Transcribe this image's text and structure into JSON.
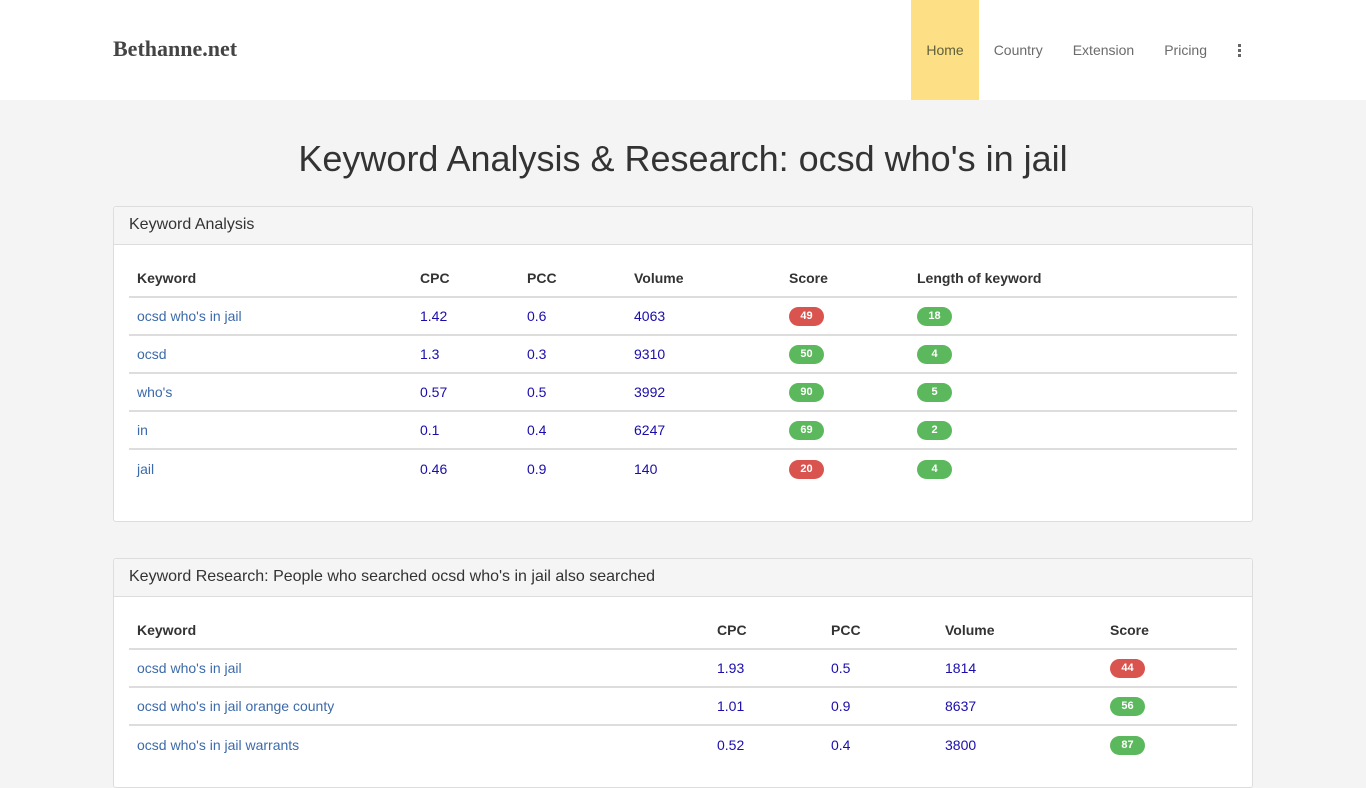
{
  "navbar": {
    "brand": "Bethanne.net",
    "items": [
      {
        "label": "Home",
        "active": true
      },
      {
        "label": "Country",
        "active": false
      },
      {
        "label": "Extension",
        "active": false
      },
      {
        "label": "Pricing",
        "active": false
      }
    ],
    "more_icon": "vertical-ellipsis-icon"
  },
  "page_title": "Keyword Analysis & Research: ocsd who's in jail",
  "analysis": {
    "heading": "Keyword Analysis",
    "columns": [
      "Keyword",
      "CPC",
      "PCC",
      "Volume",
      "Score",
      "Length of keyword"
    ],
    "rows": [
      {
        "keyword": "ocsd who's in jail",
        "cpc": "1.42",
        "pcc": "0.6",
        "volume": "4063",
        "score": "49",
        "score_color": "red",
        "length": "18",
        "length_color": "green"
      },
      {
        "keyword": "ocsd",
        "cpc": "1.3",
        "pcc": "0.3",
        "volume": "9310",
        "score": "50",
        "score_color": "green",
        "length": "4",
        "length_color": "green"
      },
      {
        "keyword": "who's",
        "cpc": "0.57",
        "pcc": "0.5",
        "volume": "3992",
        "score": "90",
        "score_color": "green",
        "length": "5",
        "length_color": "green"
      },
      {
        "keyword": "in",
        "cpc": "0.1",
        "pcc": "0.4",
        "volume": "6247",
        "score": "69",
        "score_color": "green",
        "length": "2",
        "length_color": "green"
      },
      {
        "keyword": "jail",
        "cpc": "0.46",
        "pcc": "0.9",
        "volume": "140",
        "score": "20",
        "score_color": "red",
        "length": "4",
        "length_color": "green"
      }
    ]
  },
  "research": {
    "heading": "Keyword Research: People who searched ocsd who's in jail also searched",
    "columns": [
      "Keyword",
      "CPC",
      "PCC",
      "Volume",
      "Score"
    ],
    "rows": [
      {
        "keyword": "ocsd who's in jail",
        "cpc": "1.93",
        "pcc": "0.5",
        "volume": "1814",
        "score": "44",
        "score_color": "red"
      },
      {
        "keyword": "ocsd who's in jail orange county",
        "cpc": "1.01",
        "pcc": "0.9",
        "volume": "8637",
        "score": "56",
        "score_color": "green"
      },
      {
        "keyword": "ocsd who's in jail warrants",
        "cpc": "0.52",
        "pcc": "0.4",
        "volume": "3800",
        "score": "87",
        "score_color": "green"
      }
    ]
  },
  "colors": {
    "active_nav_bg": "#fde085",
    "badge_green": "#5cb85c",
    "badge_red": "#d9534f",
    "link": "#3c6aab",
    "value": "#1a0dab"
  }
}
